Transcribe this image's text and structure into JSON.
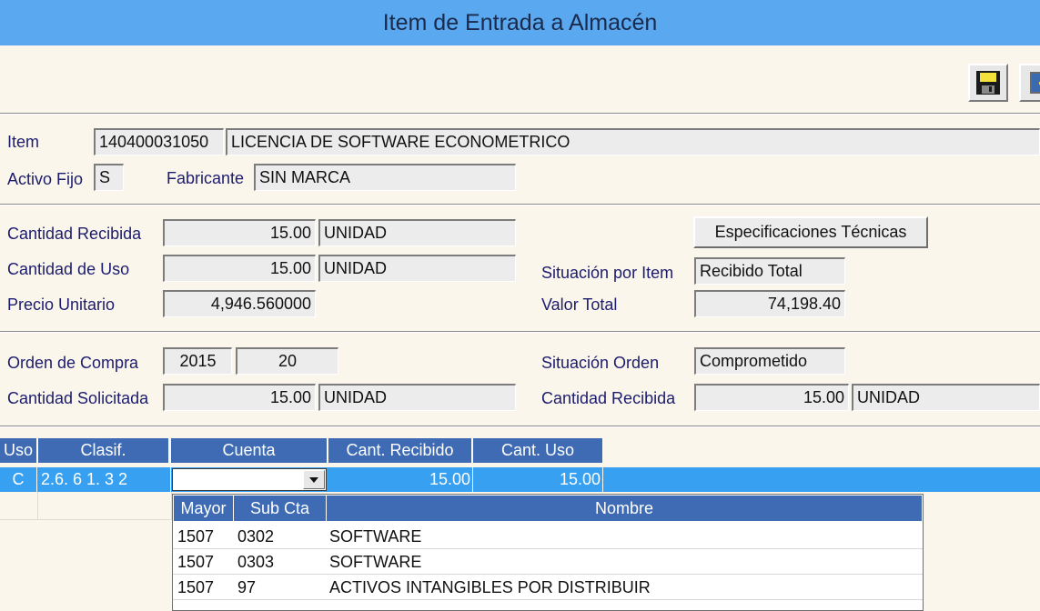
{
  "window": {
    "title": "Item de Entrada a Almacén"
  },
  "toolbar": {
    "save_icon": "save-floppy-icon",
    "exit_icon": "exit-door-icon"
  },
  "item": {
    "label": "Item",
    "code": "140400031050",
    "description": "LICENCIA DE SOFTWARE ECONOMETRICO",
    "activo_fijo_label": "Activo Fijo",
    "activo_fijo_value": "S",
    "fabricante_label": "Fabricante",
    "fabricante_value": "SIN MARCA"
  },
  "reception": {
    "cantidad_recibida_label": "Cantidad Recibida",
    "cantidad_recibida_value": "15.00",
    "cantidad_recibida_unit": "UNIDAD",
    "cantidad_uso_label": "Cantidad de Uso",
    "cantidad_uso_value": "15.00",
    "cantidad_uso_unit": "UNIDAD",
    "precio_unitario_label": "Precio Unitario",
    "precio_unitario_value": "4,946.560000",
    "specs_button": "Especificaciones Técnicas",
    "situacion_item_label": "Situación por Item",
    "situacion_item_value": "Recibido Total",
    "valor_total_label": "Valor Total",
    "valor_total_value": "74,198.40"
  },
  "order": {
    "orden_compra_label": "Orden de Compra",
    "orden_year": "2015",
    "orden_number": "20",
    "cantidad_solicitada_label": "Cantidad Solicitada",
    "cantidad_solicitada_value": "15.00",
    "cantidad_solicitada_unit": "UNIDAD",
    "situacion_orden_label": "Situación Orden",
    "situacion_orden_value": "Comprometido",
    "cantidad_recibida_label": "Cantidad Recibida",
    "cantidad_recibida_value": "15.00",
    "cantidad_recibida_unit": "UNIDAD"
  },
  "grid": {
    "headers": [
      "Uso",
      "Clasif.",
      "Cuenta",
      "Cant. Recibido",
      "Cant. Uso"
    ],
    "row": {
      "uso": "C",
      "clasif": "2.6. 6  1. 3  2",
      "cuenta": "",
      "cant_recibido": "15.00",
      "cant_uso": "15.00"
    }
  },
  "dropdown": {
    "headers": [
      "Mayor",
      "Sub Cta",
      "Nombre"
    ],
    "rows": [
      {
        "mayor": "1507",
        "sub": "0302",
        "nombre": "SOFTWARE"
      },
      {
        "mayor": "1507",
        "sub": "0303",
        "nombre": "SOFTWARE"
      },
      {
        "mayor": "1507",
        "sub": "97",
        "nombre": "ACTIVOS INTANGIBLES POR DISTRIBUIR"
      }
    ]
  },
  "colors": {
    "title_bar": "#59a8f0",
    "grid_header": "#3e6bb3",
    "selected_row": "#38a0f0",
    "label_text": "#1c1c6e",
    "background": "#fbf6ec"
  }
}
